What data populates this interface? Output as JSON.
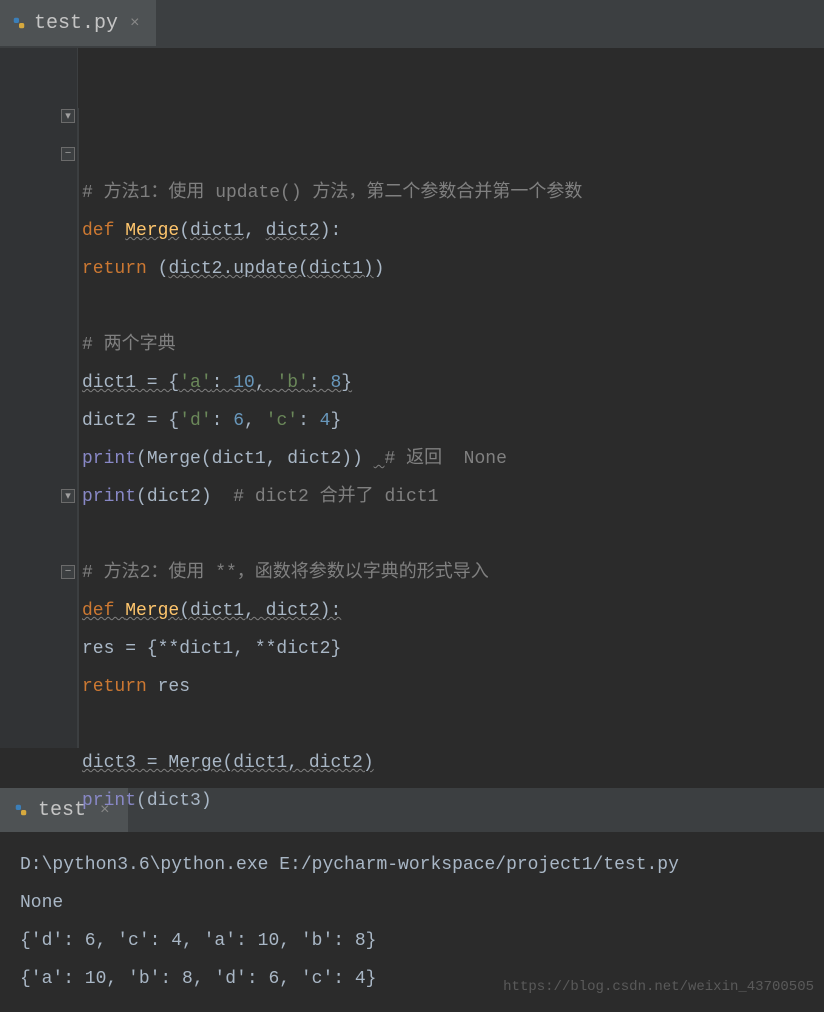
{
  "editor_tab": {
    "filename": "test.py",
    "close": "×"
  },
  "code_lines": [
    {
      "indent": 0,
      "tokens": [
        {
          "t": "comment",
          "v": "# 方法1：使用 update() 方法，第二个参数合并第一个参数"
        }
      ]
    },
    {
      "indent": 0,
      "tokens": [
        {
          "t": "kw",
          "v": "def "
        },
        {
          "t": "fn wavy-fn",
          "v": "Merge"
        },
        {
          "t": "op",
          "v": "("
        },
        {
          "t": "op wavy",
          "v": "dict1"
        },
        {
          "t": "op",
          "v": ", "
        },
        {
          "t": "op wavy",
          "v": "dict2"
        },
        {
          "t": "op",
          "v": "):"
        }
      ],
      "fold": "down"
    },
    {
      "indent": 1,
      "tokens": [
        {
          "t": "kw",
          "v": "return "
        },
        {
          "t": "op",
          "v": "("
        },
        {
          "t": "op wavy",
          "v": "dict2.update(dict1)"
        },
        {
          "t": "op",
          "v": ")"
        }
      ],
      "fold": "minus"
    },
    {
      "indent": 0,
      "tokens": []
    },
    {
      "indent": 0,
      "tokens": [
        {
          "t": "comment",
          "v": "# 两个字典"
        }
      ]
    },
    {
      "indent": 0,
      "tokens": [
        {
          "t": "op wavy",
          "v": "dict1 = {"
        },
        {
          "t": "str wavy",
          "v": "'a'"
        },
        {
          "t": "op wavy",
          "v": ": "
        },
        {
          "t": "num wavy",
          "v": "10"
        },
        {
          "t": "op wavy",
          "v": ", "
        },
        {
          "t": "str wavy",
          "v": "'b'"
        },
        {
          "t": "op wavy",
          "v": ": "
        },
        {
          "t": "num wavy",
          "v": "8"
        },
        {
          "t": "op wavy",
          "v": "}"
        }
      ]
    },
    {
      "indent": 0,
      "tokens": [
        {
          "t": "op",
          "v": "dict2 = {"
        },
        {
          "t": "str",
          "v": "'d'"
        },
        {
          "t": "op",
          "v": ": "
        },
        {
          "t": "num",
          "v": "6"
        },
        {
          "t": "op",
          "v": ", "
        },
        {
          "t": "str",
          "v": "'c'"
        },
        {
          "t": "op",
          "v": ": "
        },
        {
          "t": "num",
          "v": "4"
        },
        {
          "t": "op",
          "v": "}"
        }
      ]
    },
    {
      "indent": 0,
      "tokens": [
        {
          "t": "builtin",
          "v": "print"
        },
        {
          "t": "op",
          "v": "(Merge(dict1, dict2)) "
        },
        {
          "t": "op wavy",
          "v": " "
        },
        {
          "t": "comment",
          "v": "# 返回  None"
        }
      ]
    },
    {
      "indent": 0,
      "tokens": [
        {
          "t": "builtin",
          "v": "print"
        },
        {
          "t": "op",
          "v": "(dict2)  "
        },
        {
          "t": "comment",
          "v": "# dict2 合并了 dict1"
        }
      ]
    },
    {
      "indent": 0,
      "tokens": []
    },
    {
      "indent": 0,
      "tokens": [
        {
          "t": "comment",
          "v": "# 方法2：使用 **，函数将参数以字典的形式导入"
        }
      ]
    },
    {
      "indent": 0,
      "tokens": [
        {
          "t": "kw wavy",
          "v": "def "
        },
        {
          "t": "fn wavy-fn",
          "v": "Merge"
        },
        {
          "t": "op wavy",
          "v": "(dict1, dict2):"
        }
      ],
      "fold": "down"
    },
    {
      "indent": 1,
      "tokens": [
        {
          "t": "op",
          "v": "res = {**dict1, **dict2}"
        }
      ]
    },
    {
      "indent": 1,
      "tokens": [
        {
          "t": "kw",
          "v": "return "
        },
        {
          "t": "op",
          "v": "res"
        }
      ],
      "fold": "minus"
    },
    {
      "indent": 0,
      "tokens": []
    },
    {
      "indent": 0,
      "tokens": [
        {
          "t": "op wavy",
          "v": "dict3 = Merge(dict1, dict2)"
        }
      ]
    },
    {
      "indent": 0,
      "tokens": [
        {
          "t": "builtin",
          "v": "print"
        },
        {
          "t": "op",
          "v": "(dict3)"
        }
      ]
    }
  ],
  "console_tab": {
    "name": "test",
    "close": "×"
  },
  "console_output": [
    "D:\\python3.6\\python.exe E:/pycharm-workspace/project1/test.py",
    "None",
    "{'d': 6, 'c': 4, 'a': 10, 'b': 8}",
    "{'a': 10, 'b': 8, 'd': 6, 'c': 4}"
  ],
  "watermark": "https://blog.csdn.net/weixin_43700505"
}
